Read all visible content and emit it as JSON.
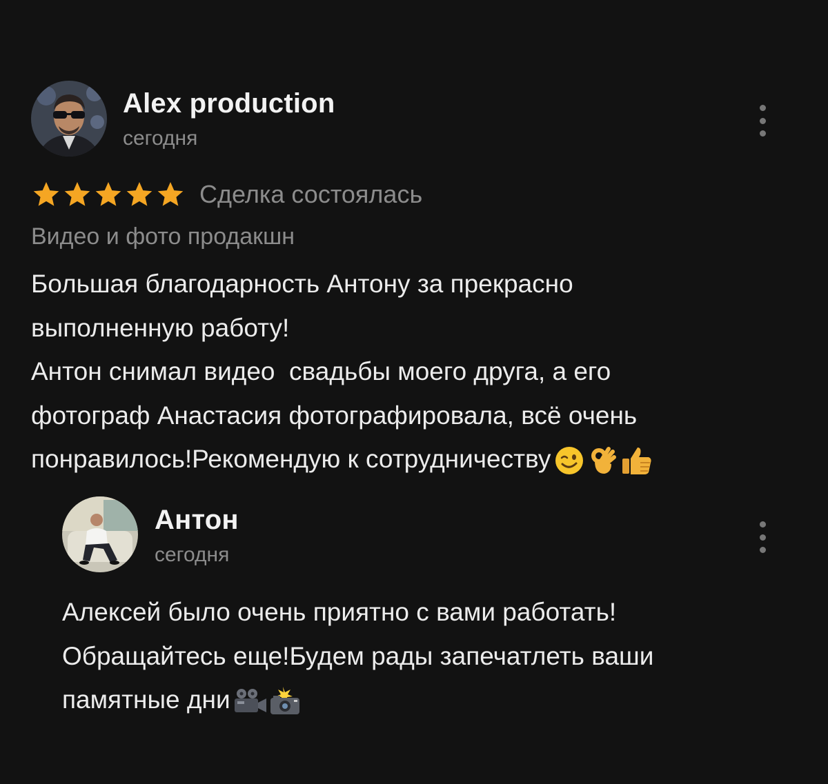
{
  "review": {
    "author": "Alex production",
    "date": "сегодня",
    "rating": 5,
    "deal_status": "Сделка состоялась",
    "category": "Видео и фото продакшн",
    "text_lines": [
      "Большая благодарность Антону за прекрасно",
      "выполненную работу!",
      "Антон снимал видео  свадьбы моего друга, а его",
      "фотограф Анастасия фотографировала, всё очень",
      "понравилось!Рекомендую к сотрудничеству"
    ],
    "text_emojis": [
      "winking-face-emoji",
      "ok-hand-emoji",
      "thumbs-up-emoji"
    ]
  },
  "reply": {
    "author": "Антон",
    "date": "сегодня",
    "text_lines": [
      "Алексей было очень приятно с вами работать!",
      "Обращайтесь еще!Будем рады запечатлеть ваши",
      "памятные дни"
    ],
    "text_emojis": [
      "movie-camera-emoji",
      "camera-with-flash-emoji"
    ]
  },
  "colors": {
    "background": "#121212",
    "primary_text": "#ececec",
    "secondary_text": "#8c8c8c",
    "star": "#f5a623"
  }
}
